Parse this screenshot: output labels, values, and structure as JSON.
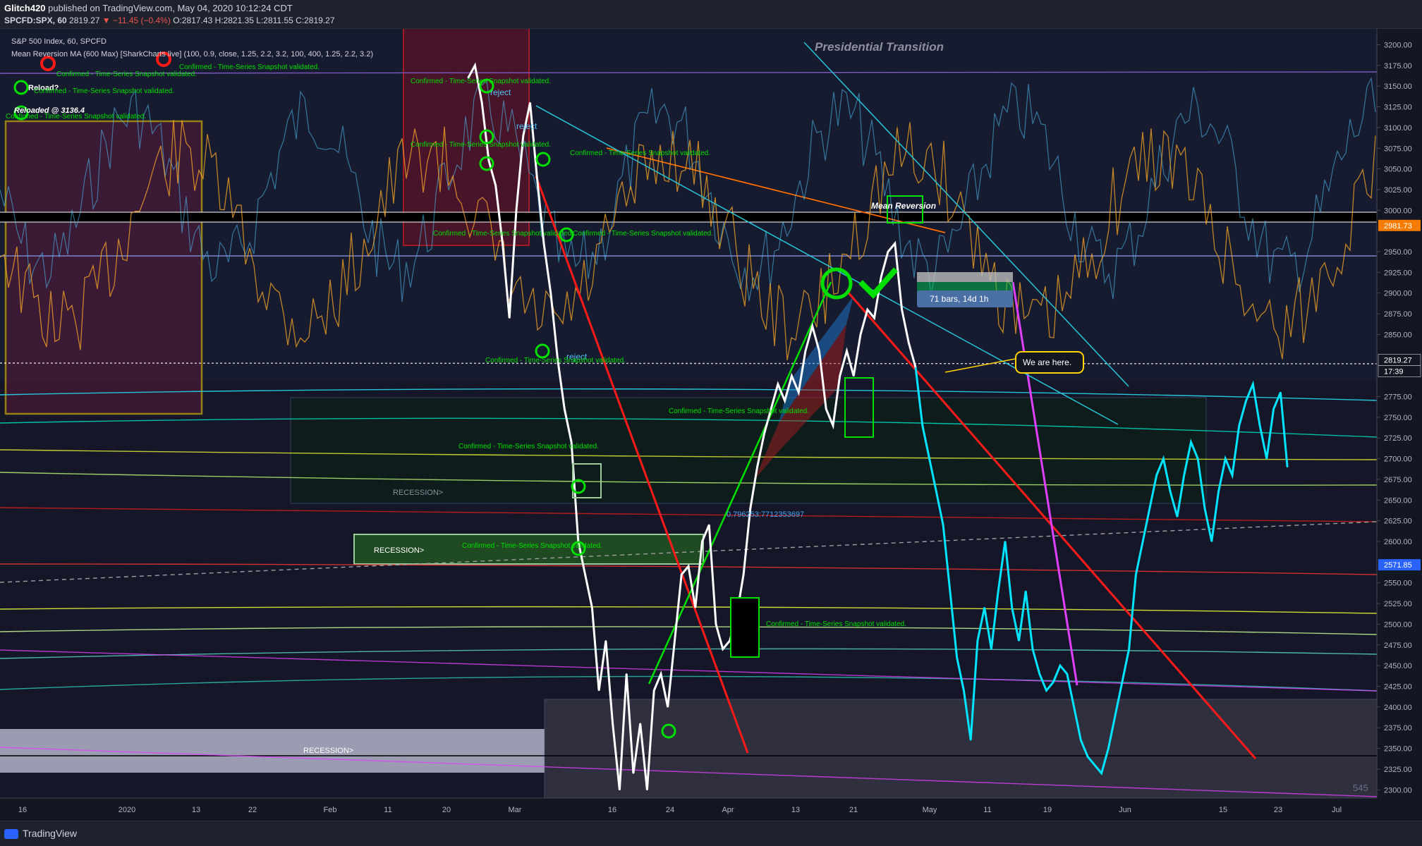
{
  "header": {
    "author": "Glitch420",
    "published_text": "published on TradingView.com, May 04, 2020 10:12:24 CDT",
    "symbol": "SPCFD:SPX, 60",
    "last": "2819.27",
    "change_arrow": "▼",
    "change": "−11.45 (−0.4%)",
    "ohlc": "O:2817.43 H:2821.35 L:2811.55 C:2819.27",
    "indicator1": "S&P 500 Index, 60, SPCFD",
    "indicator2": "Mean Reversion MA (600 Max) [SharkCharts live] (100, 0.9, close, 1.25, 2.2, 3.2, 100, 400, 1.25, 2.2, 3.2)"
  },
  "footer": {
    "brand": "TradingView"
  },
  "colors": {
    "background": "#131722",
    "price": "#ffffff",
    "projection_cyan": "#00e5ff",
    "trend_red": "#ff1a1a",
    "trend_green": "#00e000",
    "projection_magenta": "#e040fb",
    "box_yellow": "#ffd400",
    "label_price_bg": "#131722",
    "mr_price_bg": "#f57c00",
    "ma_price_bg": "#2962ff"
  },
  "annotations": {
    "presidential": "Presidential Transition",
    "mean_reversion": "Mean Reversion",
    "bars_label": "71 bars, 14d 1h",
    "we_are_here": "We are here.",
    "reload": "Reload?",
    "reloaded": "Reloaded @ 3136.4",
    "reject": "reject",
    "recession": "RECESSION>",
    "confirmed": "Confirmed - Time-Series Snapshot validated.",
    "fib_label": "0.796253:7712353697",
    "watermark": "545"
  },
  "chart_data": {
    "type": "line",
    "title": "S&P 500 Index, 60, SPCFD",
    "ylabel": "",
    "ylim": [
      2290,
      3220
    ],
    "x_tick_labels": [
      "16",
      "2020",
      "13",
      "22",
      "Feb",
      "11",
      "20",
      "Mar",
      "16",
      "24",
      "Apr",
      "13",
      "21",
      "May",
      "11",
      "19",
      "Jun",
      "15",
      "23",
      "Jul"
    ],
    "y_tick_labels": [
      "3200.00",
      "3175.00",
      "3150.00",
      "3125.00",
      "3100.00",
      "3075.00",
      "3050.00",
      "3025.00",
      "3000.00",
      "2950.00",
      "2925.00",
      "2900.00",
      "2875.00",
      "2850.00",
      "2775.00",
      "2750.00",
      "2725.00",
      "2700.00",
      "2675.00",
      "2650.00",
      "2625.00",
      "2600.00",
      "2550.00",
      "2525.00",
      "2500.00",
      "2475.00",
      "2450.00",
      "2425.00",
      "2400.00",
      "2375.00",
      "2350.00",
      "2325.00",
      "2300.00"
    ],
    "price_labels": [
      {
        "value": "2981.73",
        "kind": "mean_reversion"
      },
      {
        "value": "2819.27",
        "kind": "last_price"
      },
      {
        "value": "17:39",
        "kind": "countdown"
      },
      {
        "value": "2571.85",
        "kind": "moving_average"
      }
    ],
    "series": [
      {
        "name": "S&P 500 Index",
        "points": [
          [
            0.34,
            3160
          ],
          [
            0.345,
            3175
          ],
          [
            0.35,
            3130
          ],
          [
            0.355,
            3060
          ],
          [
            0.36,
            3030
          ],
          [
            0.365,
            2960
          ],
          [
            0.37,
            2870
          ],
          [
            0.375,
            3000
          ],
          [
            0.38,
            3090
          ],
          [
            0.385,
            3130
          ],
          [
            0.39,
            3040
          ],
          [
            0.395,
            2960
          ],
          [
            0.4,
            2900
          ],
          [
            0.405,
            2820
          ],
          [
            0.41,
            2760
          ],
          [
            0.415,
            2720
          ],
          [
            0.42,
            2600
          ],
          [
            0.425,
            2560
          ],
          [
            0.43,
            2520
          ],
          [
            0.435,
            2420
          ],
          [
            0.44,
            2480
          ],
          [
            0.445,
            2380
          ],
          [
            0.45,
            2300
          ],
          [
            0.455,
            2440
          ],
          [
            0.46,
            2320
          ],
          [
            0.465,
            2380
          ],
          [
            0.47,
            2300
          ],
          [
            0.475,
            2420
          ],
          [
            0.48,
            2440
          ],
          [
            0.485,
            2400
          ],
          [
            0.49,
            2480
          ],
          [
            0.495,
            2560
          ],
          [
            0.5,
            2570
          ],
          [
            0.505,
            2520
          ],
          [
            0.51,
            2600
          ],
          [
            0.515,
            2620
          ],
          [
            0.52,
            2500
          ],
          [
            0.525,
            2470
          ],
          [
            0.53,
            2480
          ],
          [
            0.535,
            2510
          ],
          [
            0.54,
            2560
          ],
          [
            0.545,
            2640
          ],
          [
            0.55,
            2690
          ],
          [
            0.555,
            2730
          ],
          [
            0.56,
            2760
          ],
          [
            0.565,
            2790
          ],
          [
            0.57,
            2770
          ],
          [
            0.575,
            2800
          ],
          [
            0.58,
            2780
          ],
          [
            0.585,
            2830
          ],
          [
            0.59,
            2860
          ],
          [
            0.595,
            2830
          ],
          [
            0.6,
            2760
          ],
          [
            0.605,
            2740
          ],
          [
            0.61,
            2800
          ],
          [
            0.615,
            2830
          ],
          [
            0.62,
            2800
          ],
          [
            0.625,
            2850
          ],
          [
            0.63,
            2880
          ],
          [
            0.635,
            2870
          ],
          [
            0.64,
            2920
          ],
          [
            0.645,
            2950
          ],
          [
            0.65,
            2960
          ],
          [
            0.655,
            2880
          ],
          [
            0.66,
            2840
          ],
          [
            0.665,
            2810
          ]
        ]
      },
      {
        "name": "Projection",
        "points": [
          [
            0.665,
            2810
          ],
          [
            0.67,
            2740
          ],
          [
            0.675,
            2700
          ],
          [
            0.68,
            2660
          ],
          [
            0.685,
            2620
          ],
          [
            0.69,
            2540
          ],
          [
            0.695,
            2460
          ],
          [
            0.7,
            2420
          ],
          [
            0.705,
            2360
          ],
          [
            0.71,
            2480
          ],
          [
            0.715,
            2520
          ],
          [
            0.72,
            2470
          ],
          [
            0.725,
            2540
          ],
          [
            0.73,
            2600
          ],
          [
            0.735,
            2520
          ],
          [
            0.74,
            2480
          ],
          [
            0.745,
            2540
          ],
          [
            0.75,
            2470
          ],
          [
            0.755,
            2440
          ],
          [
            0.76,
            2420
          ],
          [
            0.765,
            2430
          ],
          [
            0.77,
            2450
          ],
          [
            0.775,
            2440
          ],
          [
            0.78,
            2400
          ],
          [
            0.785,
            2360
          ],
          [
            0.79,
            2340
          ],
          [
            0.795,
            2330
          ],
          [
            0.8,
            2320
          ],
          [
            0.805,
            2350
          ],
          [
            0.81,
            2390
          ],
          [
            0.815,
            2430
          ],
          [
            0.82,
            2470
          ],
          [
            0.825,
            2560
          ],
          [
            0.83,
            2600
          ],
          [
            0.835,
            2640
          ],
          [
            0.84,
            2680
          ],
          [
            0.845,
            2700
          ],
          [
            0.85,
            2660
          ],
          [
            0.855,
            2630
          ],
          [
            0.86,
            2680
          ],
          [
            0.865,
            2720
          ],
          [
            0.87,
            2700
          ],
          [
            0.875,
            2640
          ],
          [
            0.88,
            2600
          ],
          [
            0.885,
            2660
          ],
          [
            0.89,
            2700
          ],
          [
            0.895,
            2680
          ],
          [
            0.9,
            2740
          ],
          [
            0.905,
            2770
          ],
          [
            0.91,
            2790
          ],
          [
            0.915,
            2740
          ],
          [
            0.92,
            2700
          ],
          [
            0.925,
            2760
          ],
          [
            0.93,
            2780
          ],
          [
            0.935,
            2690
          ]
        ]
      }
    ]
  }
}
